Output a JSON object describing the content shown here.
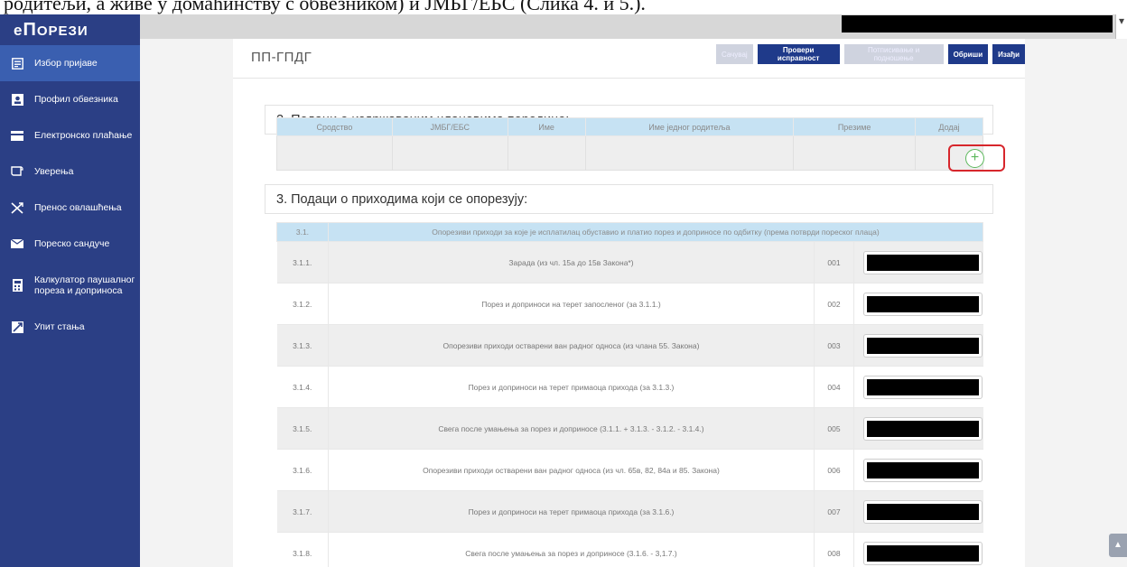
{
  "doc_strip": "родитељи, а живе у домаћинству с обвезником) и ЈМБГ/ЕБС (Слика 4. и 5.).",
  "logo": {
    "text_a": "е",
    "text_b": "П",
    "text_c": "орези"
  },
  "sidebar": {
    "items": [
      {
        "label": "Избор пријаве",
        "icon": "form-select-icon",
        "active": true
      },
      {
        "label": "Профил обвезника",
        "icon": "profile-card-icon"
      },
      {
        "label": "Електронско плаћање",
        "icon": "credit-card-icon"
      },
      {
        "label": "Уверења",
        "icon": "certificate-icon"
      },
      {
        "label": "Пренос овлашћења",
        "icon": "transfer-icon"
      },
      {
        "label": "Пореско сандуче",
        "icon": "mailbox-icon"
      },
      {
        "label": "Калкулатор паушалног",
        "label2": "пореза и доприноса",
        "icon": "calculator-icon"
      },
      {
        "label": "Упит стања",
        "icon": "balance-chart-icon"
      }
    ]
  },
  "header": {
    "form_code": "ПП-ГПДГ",
    "buttons": {
      "save": "Сачувај",
      "validate": "Провери исправност",
      "sign": "Потписивање и подношење",
      "delete": "Обриши",
      "exit": "Изађи"
    }
  },
  "section2": {
    "title": "2. Подаци о издржаваним члановима породице:",
    "columns": [
      "Сродство",
      "ЈМБГ/ЕБС",
      "Име",
      "Име једног родитеља",
      "Презиме",
      "Додај"
    ],
    "add_glyph": "+"
  },
  "section3": {
    "title": "3. Подаци о приходима који се опорезују:",
    "head": {
      "num": "3.1.",
      "desc": "Опорезиви приходи за које је исплатилац обуставио и платио порез и доприносе по одбитку (према потврди пореског плаца)"
    },
    "rows": [
      {
        "num": "3.1.1.",
        "desc": "Зарада (из чл. 15а до 15в Закона*)",
        "code": "001"
      },
      {
        "num": "3.1.2.",
        "desc": "Порез и доприноси на терет запосленог (за 3.1.1.)",
        "code": "002"
      },
      {
        "num": "3.1.3.",
        "desc": "Опорезиви приходи остварени ван радног односа (из члана 55. Закона)",
        "code": "003"
      },
      {
        "num": "3.1.4.",
        "desc": "Порез и доприноси на терет примаоца прихода (за 3.1.3.)",
        "code": "004"
      },
      {
        "num": "3.1.5.",
        "desc": "Свега после умањења за порез и доприносе (3.1.1. + 3.1.3. - 3.1.2. - 3.1.4.)",
        "code": "005"
      },
      {
        "num": "3.1.6.",
        "desc": "Опорезиви приходи остварени ван радног односа (из чл. 65в, 82, 84а и 85. Закона)",
        "code": "006"
      },
      {
        "num": "3.1.7.",
        "desc": "Порез и доприноси на терет примаоца прихода (за 3.1.6.)",
        "code": "007"
      },
      {
        "num": "3.1.8.",
        "desc": "Свега после умањења за порез и доприносе (3.1.6. - 3,1.7.)",
        "code": "008"
      }
    ]
  }
}
